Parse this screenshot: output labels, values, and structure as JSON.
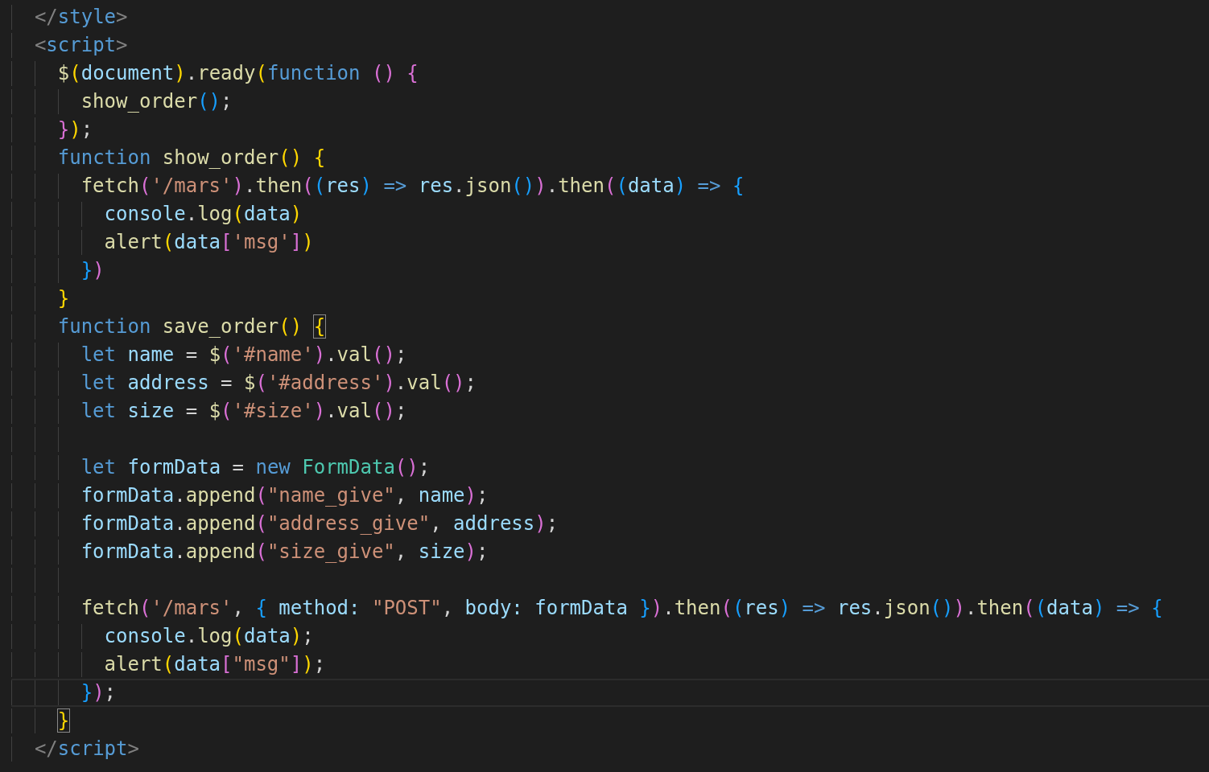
{
  "editor": {
    "lines": [
      {
        "kind": "code",
        "current": false,
        "tokens": [
          {
            "text": "</",
            "kind": "tag"
          },
          {
            "text": "style",
            "kind": "tagname"
          },
          {
            "text": ">",
            "kind": "tag"
          }
        ]
      },
      {
        "kind": "code",
        "current": false,
        "tokens": [
          {
            "text": "<",
            "kind": "tag"
          },
          {
            "text": "script",
            "kind": "tagname"
          },
          {
            "text": ">",
            "kind": "tag"
          }
        ],
        "children": [
          {
            "kind": "code",
            "current": false,
            "tokens": [
              {
                "text": "$",
                "kind": "function"
              },
              {
                "text": "(",
                "kind": "bracket1"
              },
              {
                "text": "document",
                "kind": "variable"
              },
              {
                "text": ")",
                "kind": "bracket1"
              },
              {
                "text": ".",
                "kind": "punctuation"
              },
              {
                "text": "ready",
                "kind": "function"
              },
              {
                "text": "(",
                "kind": "bracket1"
              },
              {
                "text": "function ",
                "kind": "keyword"
              },
              {
                "text": "() {",
                "kind": "bracket2"
              }
            ],
            "children": [
              {
                "kind": "code",
                "current": false,
                "tokens": [
                  {
                    "text": "show_order",
                    "kind": "function"
                  },
                  {
                    "text": "()",
                    "kind": "bracket3"
                  },
                  {
                    "text": ";",
                    "kind": "punctuation"
                  }
                ]
              }
            ]
          },
          {
            "kind": "code",
            "current": false,
            "tokens": [
              {
                "text": "}",
                "kind": "bracket2"
              },
              {
                "text": ")",
                "kind": "bracket1"
              },
              {
                "text": ";",
                "kind": "punctuation"
              }
            ]
          },
          {
            "kind": "code",
            "current": false,
            "tokens": [
              {
                "text": "function",
                "kind": "keyword"
              },
              {
                "text": " show_order",
                "kind": "function"
              },
              {
                "text": "() {",
                "kind": "bracket1"
              }
            ],
            "children": [
              {
                "kind": "code",
                "current": false,
                "tokens": [
                  {
                    "text": "fetch",
                    "kind": "function"
                  },
                  {
                    "text": "(",
                    "kind": "bracket2"
                  },
                  {
                    "text": "'/mars'",
                    "kind": "string"
                  },
                  {
                    "text": ")",
                    "kind": "bracket2"
                  },
                  {
                    "text": ".",
                    "kind": "punctuation"
                  },
                  {
                    "text": "then",
                    "kind": "function"
                  },
                  {
                    "text": "(",
                    "kind": "bracket2"
                  },
                  {
                    "text": "(",
                    "kind": "bracket3"
                  },
                  {
                    "text": "res",
                    "kind": "variable"
                  },
                  {
                    "text": ")",
                    "kind": "bracket3"
                  },
                  {
                    "text": " => ",
                    "kind": "keyword"
                  },
                  {
                    "text": "res",
                    "kind": "variable"
                  },
                  {
                    "text": ".",
                    "kind": "punctuation"
                  },
                  {
                    "text": "json",
                    "kind": "function"
                  },
                  {
                    "text": "()",
                    "kind": "bracket3"
                  },
                  {
                    "text": ")",
                    "kind": "bracket2"
                  },
                  {
                    "text": ".",
                    "kind": "punctuation"
                  },
                  {
                    "text": "then",
                    "kind": "function"
                  },
                  {
                    "text": "(",
                    "kind": "bracket2"
                  },
                  {
                    "text": "(",
                    "kind": "bracket3"
                  },
                  {
                    "text": "data",
                    "kind": "variable"
                  },
                  {
                    "text": ")",
                    "kind": "bracket3"
                  },
                  {
                    "text": " => ",
                    "kind": "keyword"
                  },
                  {
                    "text": "{",
                    "kind": "bracket3"
                  }
                ],
                "children": [
                  {
                    "kind": "code",
                    "current": false,
                    "tokens": [
                      {
                        "text": "console",
                        "kind": "variable"
                      },
                      {
                        "text": ".",
                        "kind": "punctuation"
                      },
                      {
                        "text": "log",
                        "kind": "function"
                      },
                      {
                        "text": "(",
                        "kind": "bracket1"
                      },
                      {
                        "text": "data",
                        "kind": "variable"
                      },
                      {
                        "text": ")",
                        "kind": "bracket1"
                      }
                    ]
                  },
                  {
                    "kind": "code",
                    "current": false,
                    "tokens": [
                      {
                        "text": "alert",
                        "kind": "function"
                      },
                      {
                        "text": "(",
                        "kind": "bracket1"
                      },
                      {
                        "text": "data",
                        "kind": "variable"
                      },
                      {
                        "text": "[",
                        "kind": "bracket2"
                      },
                      {
                        "text": "'msg'",
                        "kind": "string"
                      },
                      {
                        "text": "]",
                        "kind": "bracket2"
                      },
                      {
                        "text": ")",
                        "kind": "bracket1"
                      }
                    ]
                  }
                ]
              },
              {
                "kind": "code",
                "current": false,
                "tokens": [
                  {
                    "text": "}",
                    "kind": "bracket3"
                  },
                  {
                    "text": ")",
                    "kind": "bracket2"
                  }
                ]
              }
            ]
          },
          {
            "kind": "code",
            "current": false,
            "tokens": [
              {
                "text": "}",
                "kind": "bracket1"
              }
            ]
          },
          {
            "kind": "code",
            "current": false,
            "tokens": [
              {
                "text": "function",
                "kind": "keyword"
              },
              {
                "text": " save_order",
                "kind": "function"
              },
              {
                "text": "() ",
                "kind": "bracket1"
              },
              {
                "text": "{",
                "kind": "bracket1",
                "boxed": true
              }
            ],
            "children": [
              {
                "kind": "code",
                "current": false,
                "tokens": [
                  {
                    "text": "let",
                    "kind": "keyword"
                  },
                  {
                    "text": " name",
                    "kind": "variable"
                  },
                  {
                    "text": " = ",
                    "kind": "punctuation"
                  },
                  {
                    "text": "$",
                    "kind": "function"
                  },
                  {
                    "text": "(",
                    "kind": "bracket2"
                  },
                  {
                    "text": "'#name'",
                    "kind": "string"
                  },
                  {
                    "text": ")",
                    "kind": "bracket2"
                  },
                  {
                    "text": ".",
                    "kind": "punctuation"
                  },
                  {
                    "text": "val",
                    "kind": "function"
                  },
                  {
                    "text": "()",
                    "kind": "bracket2"
                  },
                  {
                    "text": ";",
                    "kind": "punctuation"
                  }
                ]
              },
              {
                "kind": "code",
                "current": false,
                "tokens": [
                  {
                    "text": "let",
                    "kind": "keyword"
                  },
                  {
                    "text": " address",
                    "kind": "variable"
                  },
                  {
                    "text": " = ",
                    "kind": "punctuation"
                  },
                  {
                    "text": "$",
                    "kind": "function"
                  },
                  {
                    "text": "(",
                    "kind": "bracket2"
                  },
                  {
                    "text": "'#address'",
                    "kind": "string"
                  },
                  {
                    "text": ")",
                    "kind": "bracket2"
                  },
                  {
                    "text": ".",
                    "kind": "punctuation"
                  },
                  {
                    "text": "val",
                    "kind": "function"
                  },
                  {
                    "text": "()",
                    "kind": "bracket2"
                  },
                  {
                    "text": ";",
                    "kind": "punctuation"
                  }
                ]
              },
              {
                "kind": "code",
                "current": false,
                "tokens": [
                  {
                    "text": "let",
                    "kind": "keyword"
                  },
                  {
                    "text": " size",
                    "kind": "variable"
                  },
                  {
                    "text": " = ",
                    "kind": "punctuation"
                  },
                  {
                    "text": "$",
                    "kind": "function"
                  },
                  {
                    "text": "(",
                    "kind": "bracket2"
                  },
                  {
                    "text": "'#size'",
                    "kind": "string"
                  },
                  {
                    "text": ")",
                    "kind": "bracket2"
                  },
                  {
                    "text": ".",
                    "kind": "punctuation"
                  },
                  {
                    "text": "val",
                    "kind": "function"
                  },
                  {
                    "text": "()",
                    "kind": "bracket2"
                  },
                  {
                    "text": ";",
                    "kind": "punctuation"
                  }
                ]
              },
              {
                "kind": "blank",
                "current": false
              },
              {
                "kind": "code",
                "current": false,
                "tokens": [
                  {
                    "text": "let",
                    "kind": "keyword"
                  },
                  {
                    "text": " formData",
                    "kind": "variable"
                  },
                  {
                    "text": " = ",
                    "kind": "punctuation"
                  },
                  {
                    "text": "new ",
                    "kind": "keyword"
                  },
                  {
                    "text": "FormData",
                    "kind": "class"
                  },
                  {
                    "text": "()",
                    "kind": "bracket2"
                  },
                  {
                    "text": ";",
                    "kind": "punctuation"
                  }
                ]
              },
              {
                "kind": "code",
                "current": false,
                "tokens": [
                  {
                    "text": "formData",
                    "kind": "variable"
                  },
                  {
                    "text": ".",
                    "kind": "punctuation"
                  },
                  {
                    "text": "append",
                    "kind": "function"
                  },
                  {
                    "text": "(",
                    "kind": "bracket2"
                  },
                  {
                    "text": "\"name_give\"",
                    "kind": "string"
                  },
                  {
                    "text": ", ",
                    "kind": "punctuation"
                  },
                  {
                    "text": "name",
                    "kind": "variable"
                  },
                  {
                    "text": ")",
                    "kind": "bracket2"
                  },
                  {
                    "text": ";",
                    "kind": "punctuation"
                  }
                ]
              },
              {
                "kind": "code",
                "current": false,
                "tokens": [
                  {
                    "text": "formData",
                    "kind": "variable"
                  },
                  {
                    "text": ".",
                    "kind": "punctuation"
                  },
                  {
                    "text": "append",
                    "kind": "function"
                  },
                  {
                    "text": "(",
                    "kind": "bracket2"
                  },
                  {
                    "text": "\"address_give\"",
                    "kind": "string"
                  },
                  {
                    "text": ", ",
                    "kind": "punctuation"
                  },
                  {
                    "text": "address",
                    "kind": "variable"
                  },
                  {
                    "text": ")",
                    "kind": "bracket2"
                  },
                  {
                    "text": ";",
                    "kind": "punctuation"
                  }
                ]
              },
              {
                "kind": "code",
                "current": false,
                "tokens": [
                  {
                    "text": "formData",
                    "kind": "variable"
                  },
                  {
                    "text": ".",
                    "kind": "punctuation"
                  },
                  {
                    "text": "append",
                    "kind": "function"
                  },
                  {
                    "text": "(",
                    "kind": "bracket2"
                  },
                  {
                    "text": "\"size_give\"",
                    "kind": "string"
                  },
                  {
                    "text": ", ",
                    "kind": "punctuation"
                  },
                  {
                    "text": "size",
                    "kind": "variable"
                  },
                  {
                    "text": ")",
                    "kind": "bracket2"
                  },
                  {
                    "text": ";",
                    "kind": "punctuation"
                  }
                ]
              },
              {
                "kind": "blank",
                "current": false
              },
              {
                "kind": "code",
                "current": false,
                "tokens": [
                  {
                    "text": "fetch",
                    "kind": "function"
                  },
                  {
                    "text": "(",
                    "kind": "bracket2"
                  },
                  {
                    "text": "'/mars'",
                    "kind": "string"
                  },
                  {
                    "text": ", ",
                    "kind": "punctuation"
                  },
                  {
                    "text": "{",
                    "kind": "bracket3"
                  },
                  {
                    "text": " method: ",
                    "kind": "variable"
                  },
                  {
                    "text": "\"POST\"",
                    "kind": "string"
                  },
                  {
                    "text": ", ",
                    "kind": "punctuation"
                  },
                  {
                    "text": "body: formData ",
                    "kind": "variable"
                  },
                  {
                    "text": "}",
                    "kind": "bracket3"
                  },
                  {
                    "text": ")",
                    "kind": "bracket2"
                  },
                  {
                    "text": ".",
                    "kind": "punctuation"
                  },
                  {
                    "text": "then",
                    "kind": "function"
                  },
                  {
                    "text": "(",
                    "kind": "bracket2"
                  },
                  {
                    "text": "(",
                    "kind": "bracket3"
                  },
                  {
                    "text": "res",
                    "kind": "variable"
                  },
                  {
                    "text": ")",
                    "kind": "bracket3"
                  },
                  {
                    "text": " => ",
                    "kind": "keyword"
                  },
                  {
                    "text": "res",
                    "kind": "variable"
                  },
                  {
                    "text": ".",
                    "kind": "punctuation"
                  },
                  {
                    "text": "json",
                    "kind": "function"
                  },
                  {
                    "text": "()",
                    "kind": "bracket3"
                  },
                  {
                    "text": ")",
                    "kind": "bracket2"
                  },
                  {
                    "text": ".",
                    "kind": "punctuation"
                  },
                  {
                    "text": "then",
                    "kind": "function"
                  },
                  {
                    "text": "(",
                    "kind": "bracket2"
                  },
                  {
                    "text": "(",
                    "kind": "bracket3"
                  },
                  {
                    "text": "data",
                    "kind": "variable"
                  },
                  {
                    "text": ")",
                    "kind": "bracket3"
                  },
                  {
                    "text": " => ",
                    "kind": "keyword"
                  },
                  {
                    "text": "{",
                    "kind": "bracket3"
                  }
                ],
                "children": [
                  {
                    "kind": "code",
                    "current": false,
                    "tokens": [
                      {
                        "text": "console",
                        "kind": "variable"
                      },
                      {
                        "text": ".",
                        "kind": "punctuation"
                      },
                      {
                        "text": "log",
                        "kind": "function"
                      },
                      {
                        "text": "(",
                        "kind": "bracket1"
                      },
                      {
                        "text": "data",
                        "kind": "variable"
                      },
                      {
                        "text": ")",
                        "kind": "bracket1"
                      },
                      {
                        "text": ";",
                        "kind": "punctuation"
                      }
                    ]
                  },
                  {
                    "kind": "code",
                    "current": false,
                    "tokens": [
                      {
                        "text": "alert",
                        "kind": "function"
                      },
                      {
                        "text": "(",
                        "kind": "bracket1"
                      },
                      {
                        "text": "data",
                        "kind": "variable"
                      },
                      {
                        "text": "[",
                        "kind": "bracket2"
                      },
                      {
                        "text": "\"msg\"",
                        "kind": "string"
                      },
                      {
                        "text": "]",
                        "kind": "bracket2"
                      },
                      {
                        "text": ")",
                        "kind": "bracket1"
                      },
                      {
                        "text": ";",
                        "kind": "punctuation"
                      }
                    ]
                  }
                ]
              },
              {
                "kind": "code",
                "current": true,
                "tokens": [
                  {
                    "text": "}",
                    "kind": "bracket3"
                  },
                  {
                    "text": ")",
                    "kind": "bracket2"
                  },
                  {
                    "text": ";",
                    "kind": "punctuation"
                  }
                ]
              }
            ]
          },
          {
            "kind": "code",
            "current": false,
            "tokens": [
              {
                "text": "}",
                "kind": "bracket1",
                "boxed": true
              }
            ]
          }
        ]
      },
      {
        "kind": "code",
        "current": false,
        "tokens": [
          {
            "text": "</",
            "kind": "tag"
          },
          {
            "text": "script",
            "kind": "tagname"
          },
          {
            "text": ">",
            "kind": "tag"
          }
        ]
      }
    ]
  }
}
